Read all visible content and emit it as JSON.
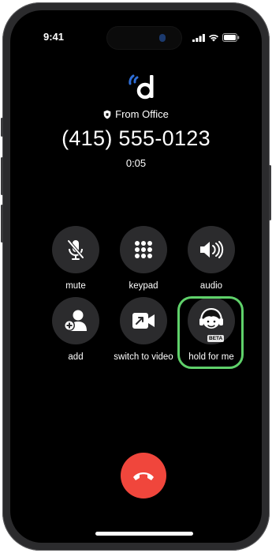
{
  "status_bar": {
    "time": "9:41"
  },
  "caller": {
    "label": "From Office",
    "number": "(415) 555-0123",
    "duration": "0:05"
  },
  "controls": {
    "mute": {
      "label": "mute",
      "icon": "mic-off-icon"
    },
    "keypad": {
      "label": "keypad",
      "icon": "keypad-icon"
    },
    "audio": {
      "label": "audio",
      "icon": "speaker-icon"
    },
    "add": {
      "label": "add",
      "icon": "add-person-icon"
    },
    "switch_to_video": {
      "label": "switch to video",
      "icon": "video-icon"
    },
    "hold_for_me": {
      "label": "hold for me",
      "icon": "agent-headset-icon",
      "badge": "BETA"
    }
  },
  "colors": {
    "background": "#000000",
    "button": "#2b2b2d",
    "end_call": "#f0463c",
    "highlight": "#5fd16a",
    "logo_blue": "#2f6fd8"
  }
}
